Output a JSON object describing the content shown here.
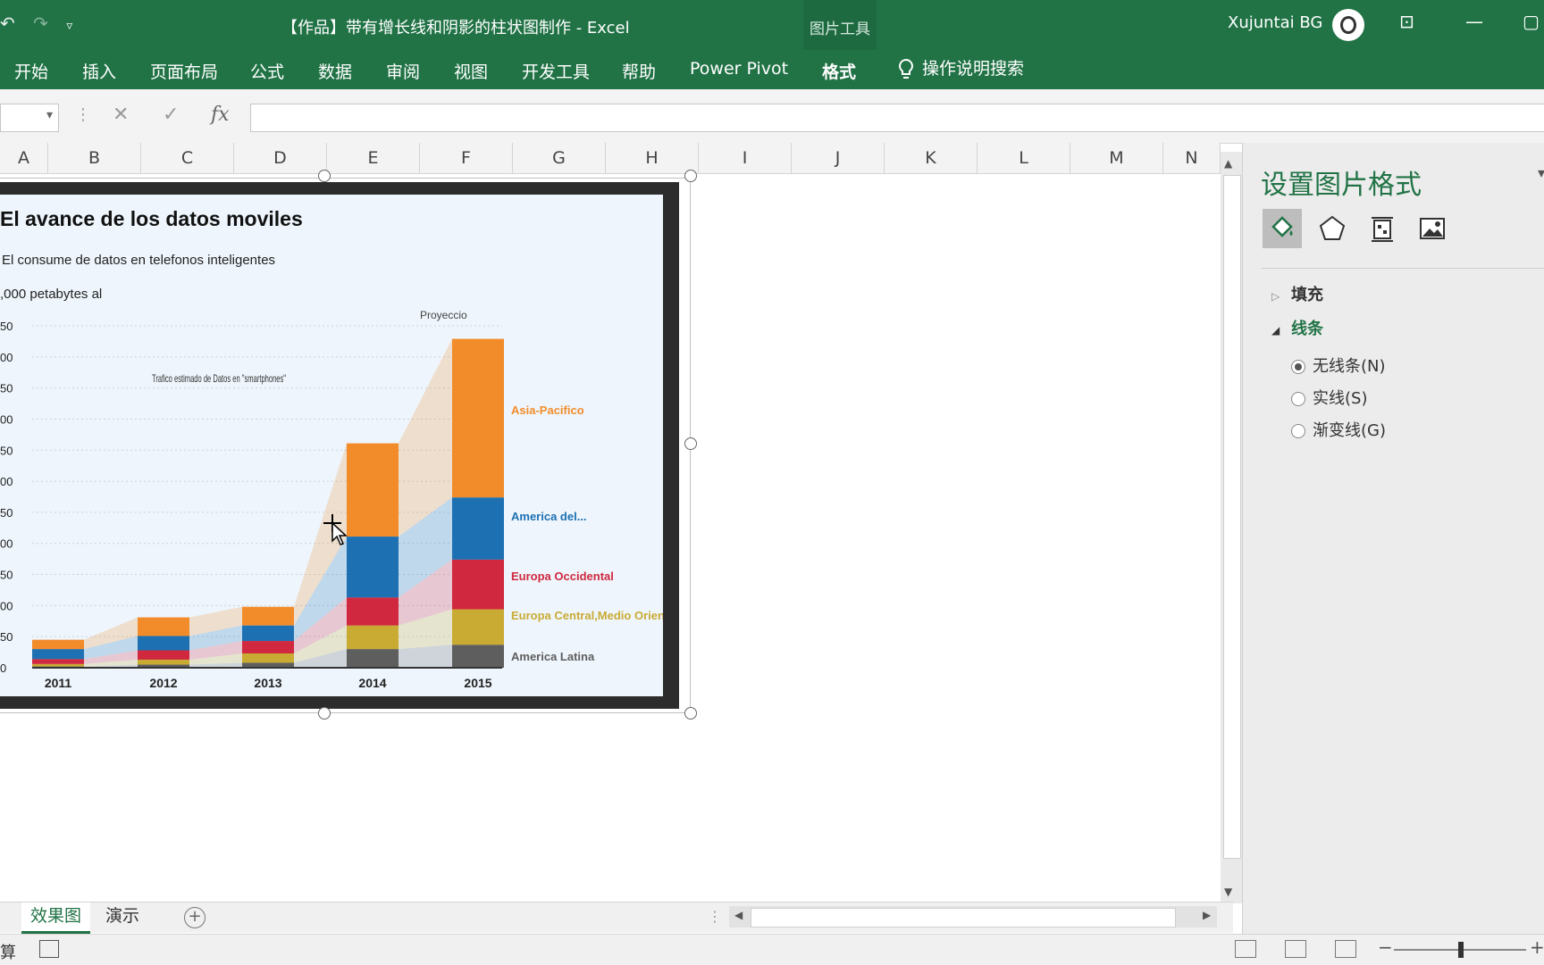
{
  "window": {
    "title": "【作品】带有增长线和阴影的柱状图制作  -  Excel",
    "context_tab_label": "图片工具",
    "user_name": "Xujuntai BG"
  },
  "ribbon": {
    "tabs": [
      "开始",
      "插入",
      "页面布局",
      "公式",
      "数据",
      "审阅",
      "视图",
      "开发工具",
      "帮助",
      "Power Pivot",
      "格式"
    ],
    "active_tab": "格式",
    "tell_me": "操作说明搜索"
  },
  "formula_bar": {
    "fx": "fx",
    "cancel": "✕",
    "enter": "✓"
  },
  "columns": [
    "A",
    "B",
    "C",
    "D",
    "E",
    "F",
    "G",
    "H",
    "I",
    "J",
    "K",
    "L",
    "M",
    "N"
  ],
  "sheets": {
    "tabs": [
      "效果图",
      "演示"
    ],
    "active": "效果图"
  },
  "status": {
    "text": "算"
  },
  "format_pane": {
    "title": "设置图片格式",
    "sections": {
      "fill": "填充",
      "line": "线条"
    },
    "line_options": [
      "无线条(N)",
      "实线(S)",
      "渐变线(G)"
    ],
    "selected_line_option": "无线条(N)"
  },
  "chart_data": {
    "type": "bar",
    "stacked": true,
    "title": "El avance de los datos moviles",
    "subtitle": "El consume de datos en telefonos inteligentes",
    "unit_label": ",000 petabytes al",
    "annotation": "Trafico estimado de Datos en \"smartphones\"",
    "projection_label": "Proyeccio",
    "categories": [
      "2011",
      "2012",
      "2013",
      "2014",
      "2015"
    ],
    "y_ticks": [
      "0",
      "50",
      "00",
      "50",
      "00",
      "50",
      "00",
      "50",
      "00",
      "50",
      "00",
      "50"
    ],
    "ylim": [
      0,
      550
    ],
    "series": [
      {
        "name": "America Latina",
        "color": "#5e5e5e",
        "values": [
          2,
          5,
          8,
          30,
          37
        ]
      },
      {
        "name": "Europa Central,Medio Oriente,Africa",
        "color": "#c9ab34",
        "values": [
          4,
          8,
          15,
          38,
          57
        ]
      },
      {
        "name": "Europa Occidental",
        "color": "#d0283e",
        "values": [
          8,
          15,
          20,
          45,
          80
        ]
      },
      {
        "name": "America del...",
        "color": "#1d71b3",
        "values": [
          16,
          23,
          25,
          98,
          100
        ]
      },
      {
        "name": "Asia-Pacifico",
        "color": "#f28c2b",
        "values": [
          15,
          30,
          30,
          150,
          255
        ]
      }
    ],
    "legend_placement": "right",
    "grid": true
  }
}
